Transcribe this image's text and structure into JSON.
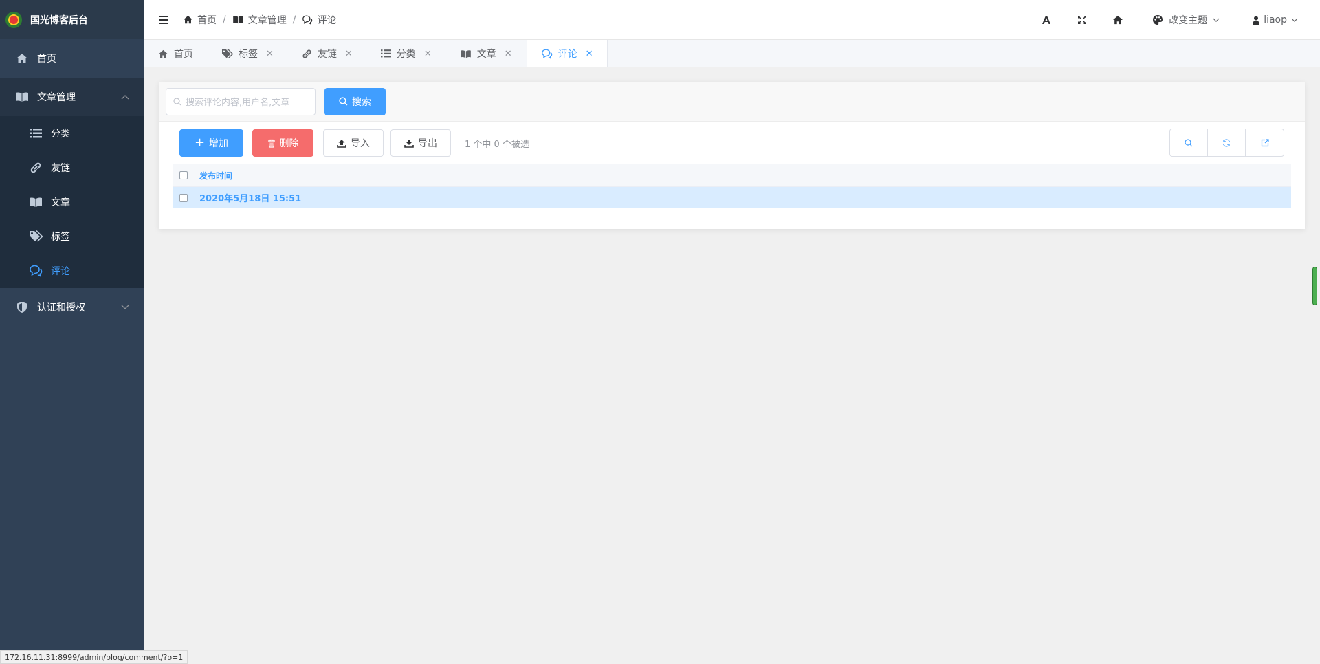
{
  "app": {
    "title": "国光博客后台"
  },
  "sidebar": {
    "items": [
      {
        "label": "首页",
        "icon": "home-icon"
      },
      {
        "label": "文章管理",
        "icon": "book-icon",
        "expanded": true
      },
      {
        "label": "认证和授权",
        "icon": "shield-icon",
        "expanded": false
      }
    ],
    "subitems": [
      {
        "label": "分类",
        "icon": "list-icon"
      },
      {
        "label": "友链",
        "icon": "link-icon"
      },
      {
        "label": "文章",
        "icon": "book-icon"
      },
      {
        "label": "标签",
        "icon": "tags-icon"
      },
      {
        "label": "评论",
        "icon": "comments-icon",
        "active": true
      }
    ]
  },
  "navbar": {
    "breadcrumb": [
      {
        "label": "首页",
        "icon": "home-icon"
      },
      {
        "label": "文章管理",
        "icon": "book-icon"
      },
      {
        "label": "评论",
        "icon": "comments-icon"
      }
    ],
    "breadcrumb_separator": "/",
    "theme_label": "改变主题",
    "user_label": "liaop"
  },
  "tags": [
    {
      "label": "首页",
      "icon": "home-icon",
      "closable": false
    },
    {
      "label": "标签",
      "icon": "tags-icon",
      "closable": true
    },
    {
      "label": "友链",
      "icon": "link-icon",
      "closable": true
    },
    {
      "label": "分类",
      "icon": "list-icon",
      "closable": true
    },
    {
      "label": "文章",
      "icon": "book-icon",
      "closable": true
    },
    {
      "label": "评论",
      "icon": "comments-icon",
      "closable": true,
      "active": true
    }
  ],
  "search": {
    "placeholder": "搜索评论内容,用户名,文章",
    "button_label": "搜索"
  },
  "toolbar": {
    "add_label": "增加",
    "delete_label": "删除",
    "import_label": "导入",
    "export_label": "导出",
    "selection_text": "1 个中 0 个被选"
  },
  "table": {
    "columns": [
      "发布时间"
    ],
    "rows": [
      {
        "published": "2020年5月18日 15:51"
      }
    ]
  },
  "statusbar": {
    "url": "172.16.11.31:8999/admin/blog/comment/?o=1"
  },
  "colors": {
    "sidebar_bg": "#304156",
    "primary": "#409eff",
    "danger": "#f56c6c",
    "selected_row": "#d9ecff"
  }
}
